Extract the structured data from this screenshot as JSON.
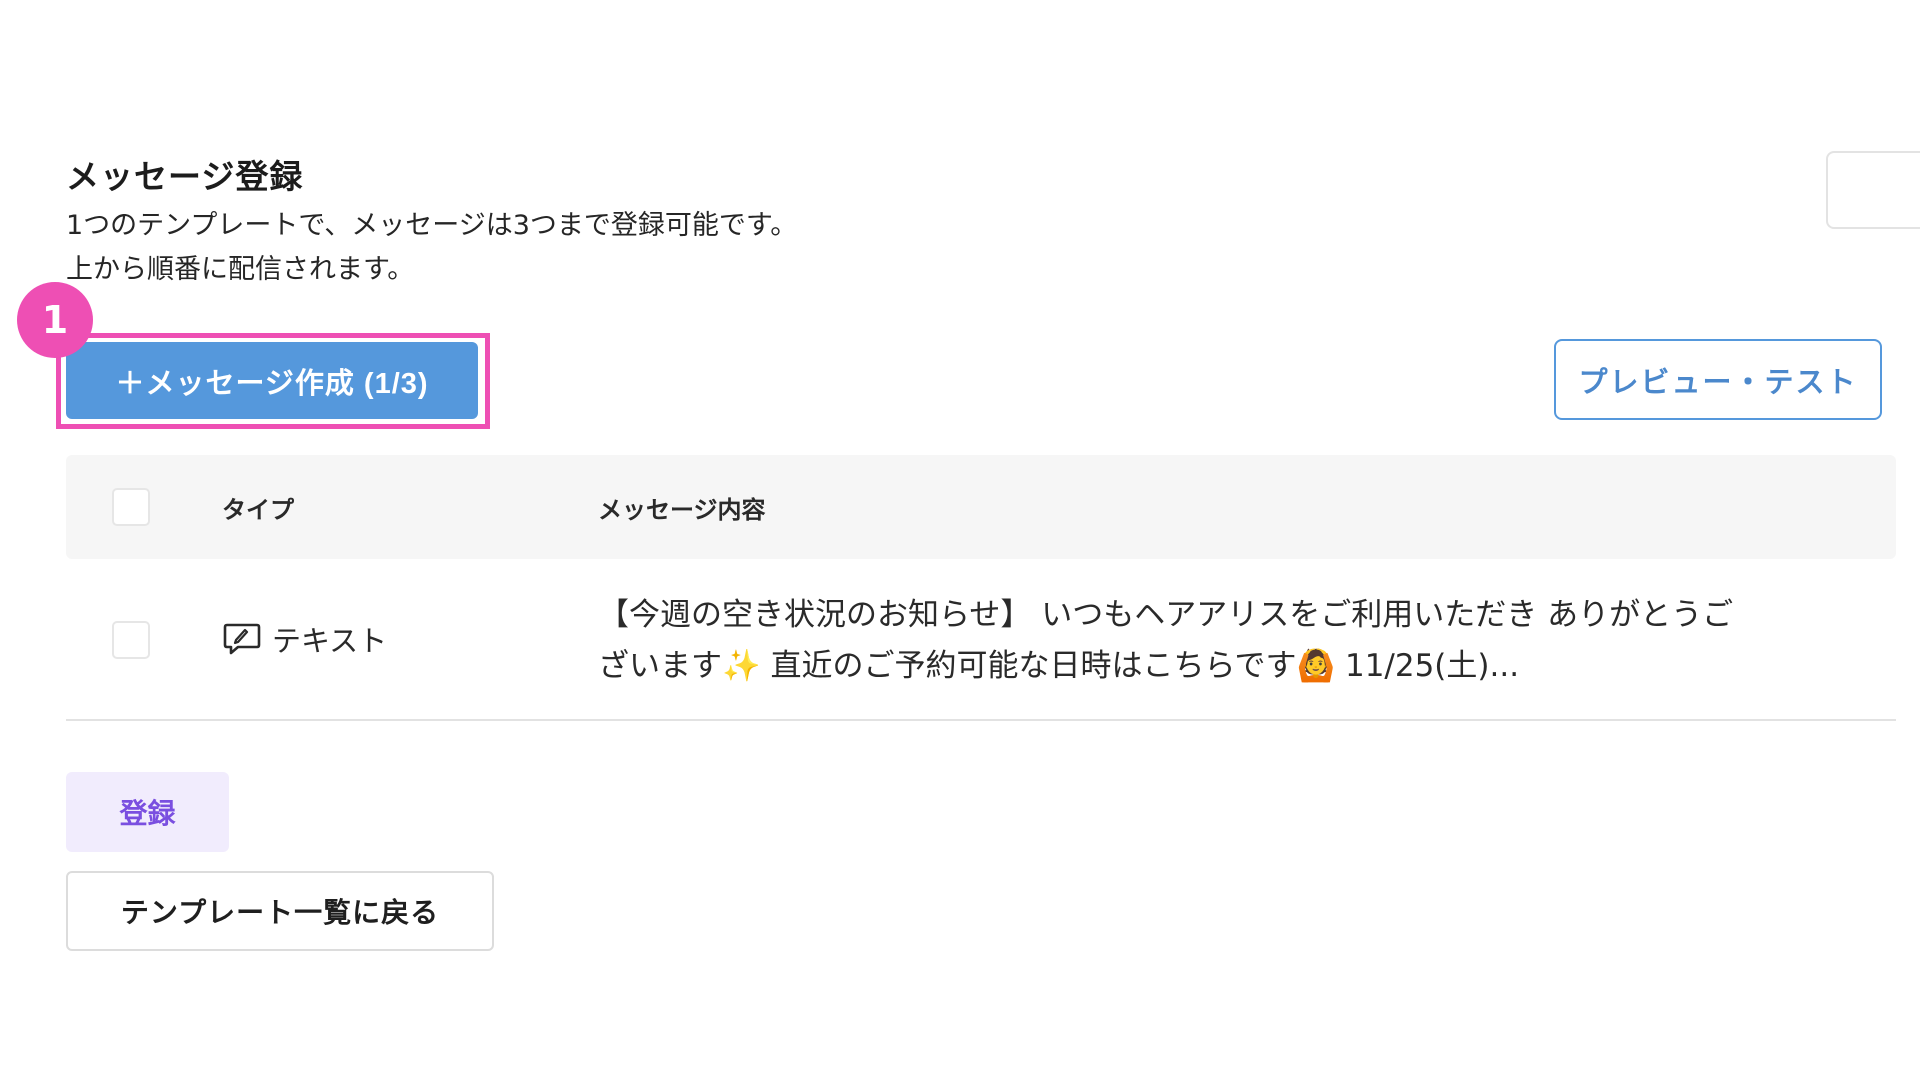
{
  "section": {
    "title": "メッセージ登録",
    "description_line1": "1つのテンプレートで、メッセージは3つまで登録可能です。",
    "description_line2": "上から順番に配信されます。"
  },
  "annotation": {
    "step_number": "1",
    "highlight_color": "#ee4fb4"
  },
  "toolbar": {
    "create_label": "＋メッセージ作成 (1/3)",
    "preview_label": "プレビュー・テスト"
  },
  "table": {
    "columns": [
      "タイプ",
      "メッセージ内容"
    ],
    "rows": [
      {
        "type_icon": "chat-bubble-icon",
        "type": "テキスト",
        "content": "【今週の空き状況のお知らせ】 いつもヘアアリスをご利用いただき ありがとうございます✨ 直近のご予約可能な日時はこちらです🙆 11/25(土)..."
      }
    ]
  },
  "actions": {
    "register_label": "登録",
    "back_label": "テンプレート一覧に戻る"
  },
  "colors": {
    "primary": "#5598dc",
    "register_bg": "#f1ecfd",
    "register_text": "#7a4fe0"
  }
}
